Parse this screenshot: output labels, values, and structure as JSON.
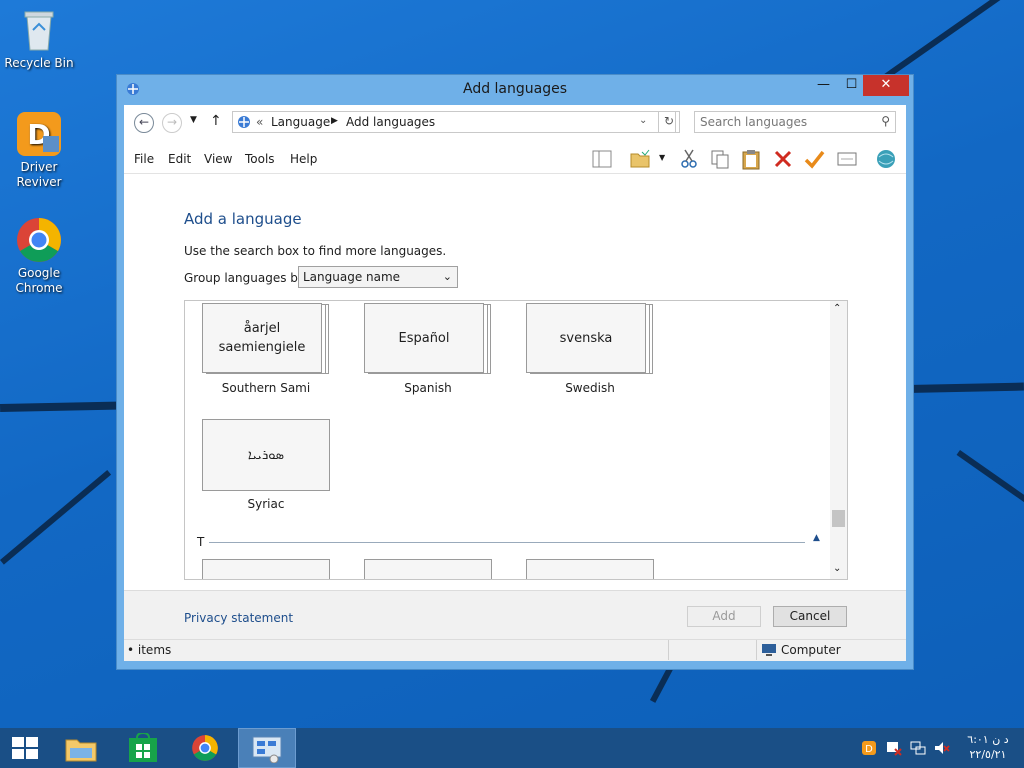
{
  "desktop": {
    "icons": [
      {
        "label": "Recycle Bin",
        "icon": "recycle-bin-icon"
      },
      {
        "label": "Driver Reviver",
        "icon": "driver-reviver-icon"
      },
      {
        "label": "Google Chrome",
        "icon": "chrome-icon"
      }
    ]
  },
  "window": {
    "title": "Add languages",
    "controls": {
      "minimize": "—",
      "maximize": "☐",
      "close": "✕"
    },
    "breadcrumb": {
      "prefix": "«",
      "items": [
        "Language",
        "Add languages"
      ]
    },
    "search_placeholder": "Search languages",
    "menu": [
      "File",
      "Edit",
      "View",
      "Tools",
      "Help"
    ],
    "heading": "Add a language",
    "hint": "Use the search box to find more languages.",
    "group_label": "Group languages by:",
    "group_value": "Language name",
    "languages": [
      {
        "native": "åarjel saemiengiele",
        "name": "Southern Sami"
      },
      {
        "native": "Español",
        "name": "Spanish"
      },
      {
        "native": "svenska",
        "name": "Swedish"
      },
      {
        "native": "ܣܘܪܝܝܐ",
        "name": "Syriac"
      }
    ],
    "section_letter": "T",
    "privacy": "Privacy statement",
    "add_button": "Add",
    "cancel_button": "Cancel",
    "status_items": "• items",
    "status_computer": "Computer"
  },
  "taskbar": {
    "clock_time": "د ن ٦:٠١",
    "clock_date": "٢٢/٥/٢١"
  },
  "colors": {
    "accent": "#1e4e8c",
    "close": "#c7322b",
    "taskbar": "#1a4f86"
  }
}
